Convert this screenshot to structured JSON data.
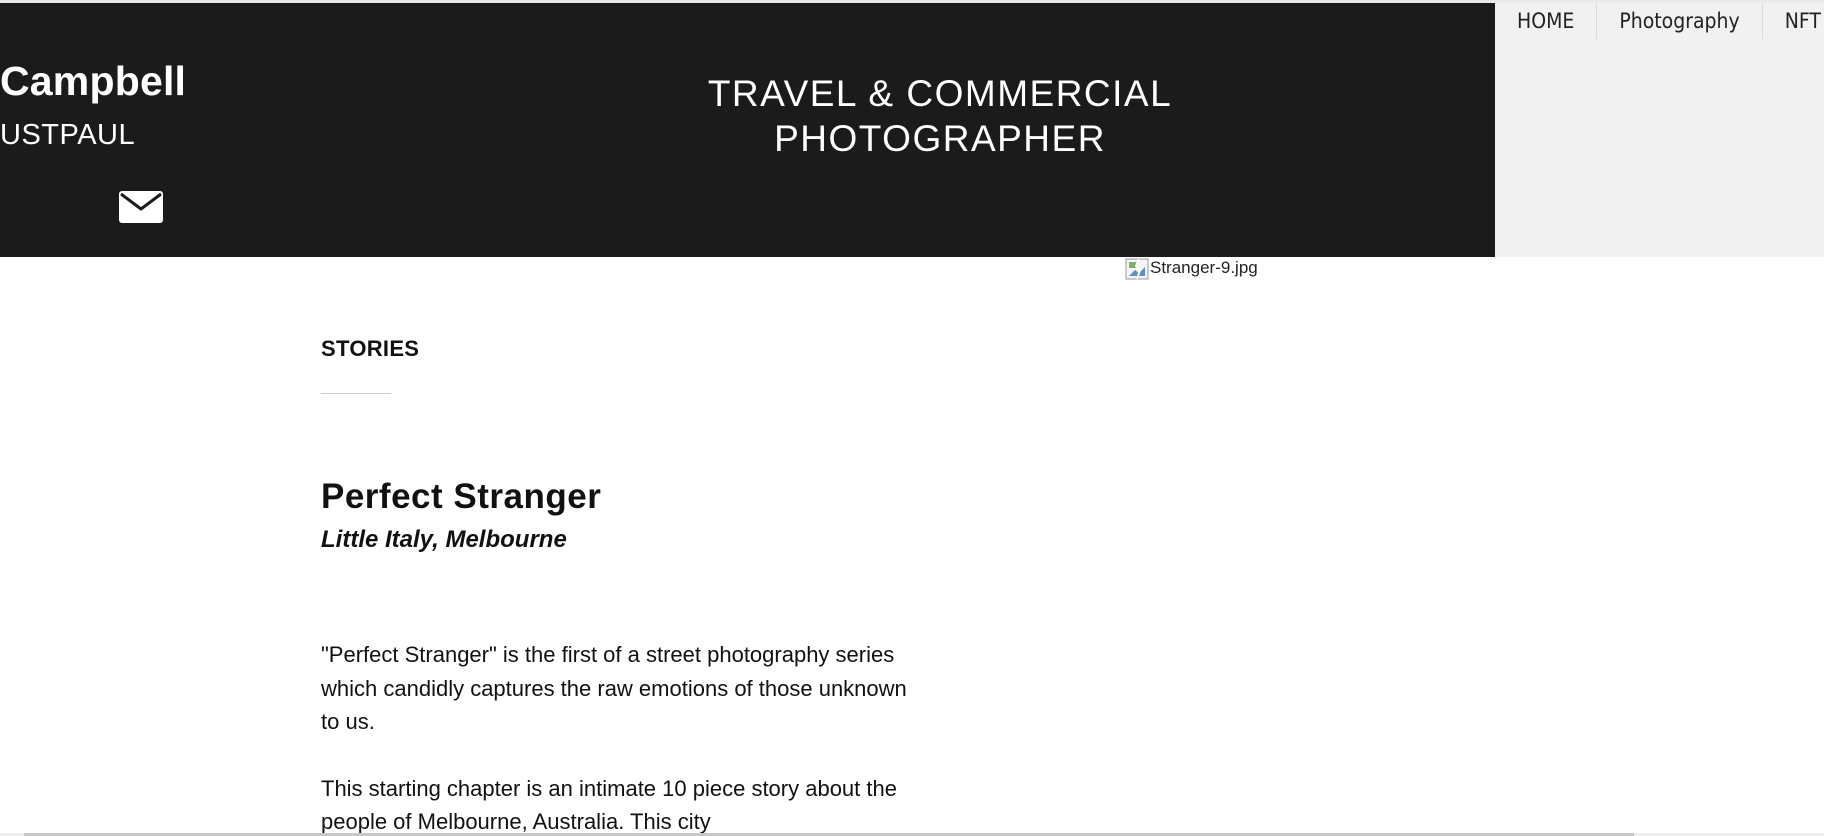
{
  "header": {
    "brand_name": "Campbell",
    "brand_handle": "USTPAUL",
    "tagline_line1": "TRAVEL & COMMERCIAL",
    "tagline_line2": "PHOTOGRAPHER",
    "icons": {
      "mail": "mail-icon"
    },
    "background_color": "#1b1b1b"
  },
  "nav": {
    "items": [
      {
        "label": "HOME"
      },
      {
        "label": "Photography"
      },
      {
        "label": "NFT"
      }
    ]
  },
  "image": {
    "alt_text": "Stranger-9.jpg",
    "icon": "broken-image-icon"
  },
  "content": {
    "section_label": "STORIES",
    "title": "Perfect Stranger",
    "subtitle": "Little Italy, Melbourne",
    "paragraphs": [
      "\"Perfect Stranger\" is the first of a street photography series which candidly captures the raw emotions of those unknown to us.",
      "This starting chapter is an intimate 10 piece story about the people of Melbourne, Australia. This city"
    ]
  }
}
